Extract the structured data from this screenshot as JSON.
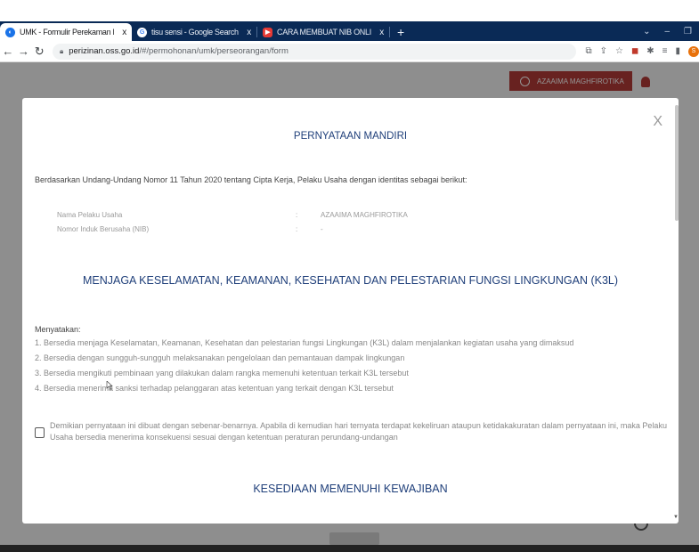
{
  "browser": {
    "tabs": [
      {
        "label": "UMK - Formulir Perekaman Pelaku",
        "close": "x",
        "favicon_color": "#1a73e8"
      },
      {
        "label": "tisu sensi - Google Search",
        "close": "x",
        "favicon_color": "#4285f4"
      },
      {
        "label": "CARA MEMBUAT NIB ONLINE DI",
        "close": "x",
        "favicon_color": "#e53935"
      }
    ],
    "new_tab": "+",
    "url_host": "perizinan.oss.go.id",
    "url_path": "/#/permohonan/umk/perseorangan/form",
    "profile_initial": "S"
  },
  "header": {
    "user_name": "AZAAIMA MAGHFIROTIKA"
  },
  "modal": {
    "title": "PERNYATAAN MANDIRI",
    "close": "X",
    "intro": "Berdasarkan Undang-Undang Nomor 11 Tahun 2020 tentang Cipta Kerja, Pelaku Usaha dengan identitas sebagai berikut:",
    "identity": [
      {
        "label": "Nama Pelaku Usaha",
        "sep": ":",
        "value": "AZAAIMA MAGHFIROTIKA"
      },
      {
        "label": "Nomor Induk Berusaha (NIB)",
        "sep": ":",
        "value": "-"
      }
    ],
    "section1_title": "MENJAGA KESELAMATAN, KEAMANAN, KESEHATAN DAN PELESTARIAN FUNGSI LINGKUNGAN (K3L)",
    "declares_label": "Menyatakan:",
    "statements": [
      "1. Bersedia menjaga Keselamatan, Keamanan, Kesehatan dan pelestarian fungsi Lingkungan (K3L) dalam menjalankan kegiatan usaha yang dimaksud",
      "2. Bersedia dengan sungguh-sungguh melaksanakan pengelolaan dan pemantauan dampak lingkungan",
      "3. Bersedia mengikuti pembinaan yang dilakukan dalam rangka memenuhi ketentuan terkait K3L tersebut",
      "4. Bersedia menerima sanksi terhadap pelanggaran atas ketentuan yang terkait dengan K3L tersebut"
    ],
    "agreement": "Demikian pernyataan ini dibuat dengan sebenar-benarnya. Apabila di kemudian hari ternyata terdapat kekeliruan ataupun ketidakakuratan dalam pernyataan ini, maka Pelaku Usaha bersedia menerima konsekuensi sesuai dengan ketentuan peraturan perundang-undangan",
    "section2_title": "KESEDIAAN MEMENUHI KEWAJIBAN"
  },
  "colors": {
    "tabbar": "#0a2a56",
    "accent_title": "#1f3f7a",
    "user_pill": "#b43b37"
  }
}
